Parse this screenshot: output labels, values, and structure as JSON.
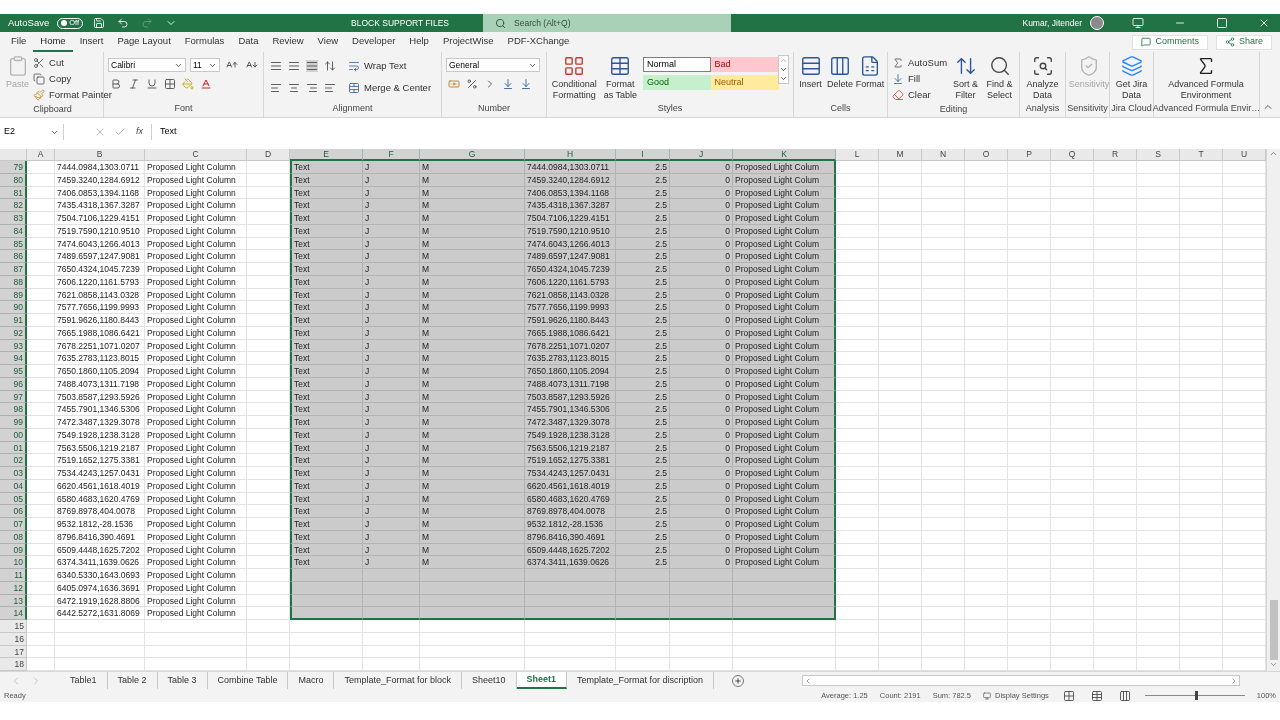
{
  "title_bar": {
    "autosave_label": "AutoSave",
    "autosave": {
      "label": "Off",
      "on": false
    },
    "title": "BLOCK SUPPORT FILES",
    "search": {
      "placeholder": "Search (Alt+Q)"
    },
    "user": "Kumar, Jitender"
  },
  "menu_tabs": [
    {
      "label": "File",
      "selected": false
    },
    {
      "label": "Home",
      "selected": true
    },
    {
      "label": "Insert",
      "selected": false
    },
    {
      "label": "Page Layout",
      "selected": false
    },
    {
      "label": "Formulas",
      "selected": false
    },
    {
      "label": "Data",
      "selected": false
    },
    {
      "label": "Review",
      "selected": false
    },
    {
      "label": "View",
      "selected": false
    },
    {
      "label": "Developer",
      "selected": false
    },
    {
      "label": "Help",
      "selected": false
    },
    {
      "label": "ProjectWise",
      "selected": false
    },
    {
      "label": "PDF-XChange",
      "selected": false
    }
  ],
  "actions": {
    "comments": "Comments",
    "share": "Share"
  },
  "ribbon": {
    "clipboard": {
      "label": "Clipboard",
      "paste": {
        "label": "Paste",
        "disabled": true
      },
      "cut": "Cut",
      "copy": "Copy",
      "format_painter": "Format Painter"
    },
    "font": {
      "label": "Font",
      "font_name": "Calibri",
      "font_size": "11"
    },
    "alignment": {
      "label": "Alignment",
      "wrap_text": "Wrap Text",
      "merge": "Merge & Center"
    },
    "number": {
      "label": "Number",
      "format": "General"
    },
    "styles": {
      "label": "Styles",
      "conditional": "Conditional Formatting",
      "format_table": "Format as Table",
      "cell_styles": [
        {
          "label": "Normal",
          "color": "#ffffff"
        },
        {
          "label": "Bad",
          "color": "#ffc7ce"
        },
        {
          "label": "Good",
          "color": "#c6efce"
        },
        {
          "label": "Neutral",
          "color": "#ffeb9c"
        }
      ]
    },
    "cells": {
      "label": "Cells",
      "buttons": [
        "Insert",
        "Delete",
        "Format"
      ]
    },
    "editing": {
      "label": "Editing",
      "autosum": "AutoSum",
      "fill": "Fill",
      "clear": "Clear",
      "sort": "Sort & Filter",
      "find": "Find & Select"
    },
    "analysis": {
      "label": "Analysis",
      "button": "Analyze Data"
    },
    "sensitivity": {
      "label": "Sensitivity",
      "button": {
        "label": "Sensitivity",
        "disabled": true
      }
    },
    "jira": {
      "label": "Jira Cloud",
      "button": "Get Jira Data"
    },
    "formula_env": {
      "label": "Advanced Formula Envir…",
      "button": "Advanced Formula Environment"
    }
  },
  "formula_bar": {
    "name_box": "E2",
    "insert_function": "fx",
    "formula": "Text"
  },
  "grid": {
    "columns": [
      {
        "label": "A",
        "selected": false,
        "kind": "text"
      },
      {
        "label": "B",
        "selected": false,
        "kind": "text"
      },
      {
        "label": "C",
        "selected": false,
        "kind": "text"
      },
      {
        "label": "D",
        "selected": false,
        "kind": "text"
      },
      {
        "label": "E",
        "selected": true,
        "kind": "text"
      },
      {
        "label": "F",
        "selected": true,
        "kind": "text"
      },
      {
        "label": "G",
        "selected": true,
        "kind": "text"
      },
      {
        "label": "H",
        "selected": true,
        "kind": "text"
      },
      {
        "label": "I",
        "selected": true,
        "kind": "number"
      },
      {
        "label": "J",
        "selected": true,
        "kind": "number"
      },
      {
        "label": "K",
        "selected": true,
        "kind": "text"
      },
      {
        "label": "L",
        "selected": false,
        "kind": "text"
      },
      {
        "label": "M",
        "selected": false,
        "kind": "text"
      },
      {
        "label": "N",
        "selected": false,
        "kind": "text"
      },
      {
        "label": "O",
        "selected": false,
        "kind": "text"
      },
      {
        "label": "P",
        "selected": false,
        "kind": "text"
      },
      {
        "label": "Q",
        "selected": false,
        "kind": "text"
      },
      {
        "label": "R",
        "selected": false,
        "kind": "text"
      },
      {
        "label": "S",
        "selected": false,
        "kind": "text"
      },
      {
        "label": "T",
        "selected": false,
        "kind": "text"
      },
      {
        "label": "U",
        "selected": false,
        "kind": "text"
      }
    ],
    "rows": [
      {
        "header": "79",
        "selected": true,
        "cells": {
          "b": "7444.0984,1303.0711",
          "c": "Proposed Light Column",
          "e": "Text",
          "f": "J",
          "g": "M",
          "h": "7444.0984,1303.0711",
          "i": "2.5",
          "j": "0",
          "k": "Proposed Light Colum"
        }
      },
      {
        "header": "80",
        "selected": true,
        "cells": {
          "b": "7459.3240,1284.6912",
          "c": "Proposed Light Column",
          "e": "Text",
          "f": "J",
          "g": "M",
          "h": "7459.3240,1284.6912",
          "i": "2.5",
          "j": "0",
          "k": "Proposed Light Colum"
        }
      },
      {
        "header": "81",
        "selected": true,
        "cells": {
          "b": "7406.0853,1394.1168",
          "c": "Proposed Light Column",
          "e": "Text",
          "f": "J",
          "g": "M",
          "h": "7406.0853,1394.1168",
          "i": "2.5",
          "j": "0",
          "k": "Proposed Light Colum"
        }
      },
      {
        "header": "82",
        "selected": true,
        "cells": {
          "b": "7435.4318,1367.3287",
          "c": "Proposed Light Column",
          "e": "Text",
          "f": "J",
          "g": "M",
          "h": "7435.4318,1367.3287",
          "i": "2.5",
          "j": "0",
          "k": "Proposed Light Colum"
        }
      },
      {
        "header": "83",
        "selected": true,
        "cells": {
          "b": "7504.7106,1229.4151",
          "c": "Proposed Light Column",
          "e": "Text",
          "f": "J",
          "g": "M",
          "h": "7504.7106,1229.4151",
          "i": "2.5",
          "j": "0",
          "k": "Proposed Light Colum"
        }
      },
      {
        "header": "84",
        "selected": true,
        "cells": {
          "b": "7519.7590,1210.9510",
          "c": "Proposed Light Column",
          "e": "Text",
          "f": "J",
          "g": "M",
          "h": "7519.7590,1210.9510",
          "i": "2.5",
          "j": "0",
          "k": "Proposed Light Colum"
        }
      },
      {
        "header": "85",
        "selected": true,
        "cells": {
          "b": "7474.6043,1266.4013",
          "c": "Proposed Light Column",
          "e": "Text",
          "f": "J",
          "g": "M",
          "h": "7474.6043,1266.4013",
          "i": "2.5",
          "j": "0",
          "k": "Proposed Light Colum"
        }
      },
      {
        "header": "86",
        "selected": true,
        "cells": {
          "b": "7489.6597,1247.9081",
          "c": "Proposed Light Column",
          "e": "Text",
          "f": "J",
          "g": "M",
          "h": "7489.6597,1247.9081",
          "i": "2.5",
          "j": "0",
          "k": "Proposed Light Colum"
        }
      },
      {
        "header": "87",
        "selected": true,
        "cells": {
          "b": "7650.4324,1045.7239",
          "c": "Proposed Light Column",
          "e": "Text",
          "f": "J",
          "g": "M",
          "h": "7650.4324,1045.7239",
          "i": "2.5",
          "j": "0",
          "k": "Proposed Light Colum"
        }
      },
      {
        "header": "88",
        "selected": true,
        "cells": {
          "b": "7606.1220,1161.5793",
          "c": "Proposed Light Column",
          "e": "Text",
          "f": "J",
          "g": "M",
          "h": "7606.1220,1161.5793",
          "i": "2.5",
          "j": "0",
          "k": "Proposed Light Colum"
        }
      },
      {
        "header": "89",
        "selected": true,
        "cells": {
          "b": "7621.0858,1143.0328",
          "c": "Proposed Light Column",
          "e": "Text",
          "f": "J",
          "g": "M",
          "h": "7621.0858,1143.0328",
          "i": "2.5",
          "j": "0",
          "k": "Proposed Light Colum"
        }
      },
      {
        "header": "90",
        "selected": true,
        "cells": {
          "b": "7577.7656,1199.9993",
          "c": "Proposed Light Column",
          "e": "Text",
          "f": "J",
          "g": "M",
          "h": "7577.7656,1199.9993",
          "i": "2.5",
          "j": "0",
          "k": "Proposed Light Colum"
        }
      },
      {
        "header": "91",
        "selected": true,
        "cells": {
          "b": "7591.9626,1180.8443",
          "c": "Proposed Light Column",
          "e": "Text",
          "f": "J",
          "g": "M",
          "h": "7591.9626,1180.8443",
          "i": "2.5",
          "j": "0",
          "k": "Proposed Light Colum"
        }
      },
      {
        "header": "92",
        "selected": true,
        "cells": {
          "b": "7665.1988,1086.6421",
          "c": "Proposed Light Column",
          "e": "Text",
          "f": "J",
          "g": "M",
          "h": "7665.1988,1086.6421",
          "i": "2.5",
          "j": "0",
          "k": "Proposed Light Colum"
        }
      },
      {
        "header": "93",
        "selected": true,
        "cells": {
          "b": "7678.2251,1071.0207",
          "c": "Proposed Light Column",
          "e": "Text",
          "f": "J",
          "g": "M",
          "h": "7678.2251,1071.0207",
          "i": "2.5",
          "j": "0",
          "k": "Proposed Light Colum"
        }
      },
      {
        "header": "94",
        "selected": true,
        "cells": {
          "b": "7635.2783,1123.8015",
          "c": "Proposed Light Column",
          "e": "Text",
          "f": "J",
          "g": "M",
          "h": "7635.2783,1123.8015",
          "i": "2.5",
          "j": "0",
          "k": "Proposed Light Colum"
        }
      },
      {
        "header": "95",
        "selected": true,
        "cells": {
          "b": "7650.1860,1105.2094",
          "c": "Proposed Light Column",
          "e": "Text",
          "f": "J",
          "g": "M",
          "h": "7650.1860,1105.2094",
          "i": "2.5",
          "j": "0",
          "k": "Proposed Light Colum"
        }
      },
      {
        "header": "96",
        "selected": true,
        "cells": {
          "b": "7488.4073,1311.7198",
          "c": "Proposed Light Column",
          "e": "Text",
          "f": "J",
          "g": "M",
          "h": "7488.4073,1311.7198",
          "i": "2.5",
          "j": "0",
          "k": "Proposed Light Colum"
        }
      },
      {
        "header": "97",
        "selected": true,
        "cells": {
          "b": "7503.8587,1293.5926",
          "c": "Proposed Light Column",
          "e": "Text",
          "f": "J",
          "g": "M",
          "h": "7503.8587,1293.5926",
          "i": "2.5",
          "j": "0",
          "k": "Proposed Light Colum"
        }
      },
      {
        "header": "98",
        "selected": true,
        "cells": {
          "b": "7455.7901,1346.5306",
          "c": "Proposed Light Column",
          "e": "Text",
          "f": "J",
          "g": "M",
          "h": "7455.7901,1346.5306",
          "i": "2.5",
          "j": "0",
          "k": "Proposed Light Colum"
        }
      },
      {
        "header": "99",
        "selected": true,
        "cells": {
          "b": "7472.3487,1329.3078",
          "c": "Proposed Light Column",
          "e": "Text",
          "f": "J",
          "g": "M",
          "h": "7472.3487,1329.3078",
          "i": "2.5",
          "j": "0",
          "k": "Proposed Light Colum"
        }
      },
      {
        "header": "00",
        "selected": true,
        "cells": {
          "b": "7549.1928,1238.3128",
          "c": "Proposed Light Column",
          "e": "Text",
          "f": "J",
          "g": "M",
          "h": "7549.1928,1238.3128",
          "i": "2.5",
          "j": "0",
          "k": "Proposed Light Colum"
        }
      },
      {
        "header": "01",
        "selected": true,
        "cells": {
          "b": "7563.5506,1219.2187",
          "c": "Proposed Light Column",
          "e": "Text",
          "f": "J",
          "g": "M",
          "h": "7563.5506,1219.2187",
          "i": "2.5",
          "j": "0",
          "k": "Proposed Light Colum"
        }
      },
      {
        "header": "02",
        "selected": true,
        "cells": {
          "b": "7519.1652,1275.3381",
          "c": "Proposed Light Column",
          "e": "Text",
          "f": "J",
          "g": "M",
          "h": "7519.1652,1275.3381",
          "i": "2.5",
          "j": "0",
          "k": "Proposed Light Colum"
        }
      },
      {
        "header": "03",
        "selected": true,
        "cells": {
          "b": "7534.4243,1257.0431",
          "c": "Proposed Light Column",
          "e": "Text",
          "f": "J",
          "g": "M",
          "h": "7534.4243,1257.0431",
          "i": "2.5",
          "j": "0",
          "k": "Proposed Light Colum"
        }
      },
      {
        "header": "04",
        "selected": true,
        "cells": {
          "b": "6620.4561,1618.4019",
          "c": "Proposed Light Column",
          "e": "Text",
          "f": "J",
          "g": "M",
          "h": "6620.4561,1618.4019",
          "i": "2.5",
          "j": "0",
          "k": "Proposed Light Colum"
        }
      },
      {
        "header": "05",
        "selected": true,
        "cells": {
          "b": "6580.4683,1620.4769",
          "c": "Proposed Light Column",
          "e": "Text",
          "f": "J",
          "g": "M",
          "h": "6580.4683,1620.4769",
          "i": "2.5",
          "j": "0",
          "k": "Proposed Light Colum"
        }
      },
      {
        "header": "06",
        "selected": true,
        "cells": {
          "b": "8769.8978,404.0078",
          "c": "Proposed Light Column",
          "e": "Text",
          "f": "J",
          "g": "M",
          "h": "8769.8978,404.0078",
          "i": "2.5",
          "j": "0",
          "k": "Proposed Light Colum"
        }
      },
      {
        "header": "07",
        "selected": true,
        "cells": {
          "b": "9532.1812,-28.1536",
          "c": "Proposed Light Column",
          "e": "Text",
          "f": "J",
          "g": "M",
          "h": "9532.1812,-28.1536",
          "i": "2.5",
          "j": "0",
          "k": "Proposed Light Colum"
        }
      },
      {
        "header": "08",
        "selected": true,
        "cells": {
          "b": "8796.8416,390.4691",
          "c": "Proposed Light Column",
          "e": "Text",
          "f": "J",
          "g": "M",
          "h": "8796.8416,390.4691",
          "i": "2.5",
          "j": "0",
          "k": "Proposed Light Colum"
        }
      },
      {
        "header": "09",
        "selected": true,
        "cells": {
          "b": "6509.4448,1625.7202",
          "c": "Proposed Light Column",
          "e": "Text",
          "f": "J",
          "g": "M",
          "h": "6509.4448,1625.7202",
          "i": "2.5",
          "j": "0",
          "k": "Proposed Light Colum"
        }
      },
      {
        "header": "10",
        "selected": true,
        "cells": {
          "b": "6374.3411,1639.0626",
          "c": "Proposed Light Column",
          "e": "Text",
          "f": "J",
          "g": "M",
          "h": "6374.3411,1639.0626",
          "i": "2.5",
          "j": "0",
          "k": "Proposed Light Colum"
        }
      },
      {
        "header": "11",
        "selected": true,
        "cells": {
          "b": "6340.5330,1643.0693",
          "c": "Proposed Light Column"
        }
      },
      {
        "header": "12",
        "selected": true,
        "cells": {
          "b": "6405.0974,1636.3691",
          "c": "Proposed Light Column"
        }
      },
      {
        "header": "13",
        "selected": true,
        "cells": {
          "b": "6472.1919,1628.8806",
          "c": "Proposed Light Column"
        }
      },
      {
        "header": "14",
        "selected": true,
        "cells": {
          "b": "6442.5272,1631.8069",
          "c": "Proposed Light Column"
        }
      },
      {
        "header": "15",
        "selected": false,
        "cells": {}
      },
      {
        "header": "16",
        "selected": false,
        "cells": {}
      },
      {
        "header": "17",
        "selected": false,
        "cells": {}
      },
      {
        "header": "18",
        "selected": false,
        "cells": {}
      }
    ]
  },
  "sheet_tabs": [
    {
      "label": "Table1",
      "selected": false
    },
    {
      "label": "Table 2",
      "selected": false
    },
    {
      "label": "Table 3",
      "selected": false
    },
    {
      "label": "Combine Table",
      "selected": false
    },
    {
      "label": "Macro",
      "selected": false
    },
    {
      "label": "Template_Format for block",
      "selected": false
    },
    {
      "label": "Sheet10",
      "selected": false
    },
    {
      "label": "Sheet1",
      "selected": true
    },
    {
      "label": "Template_Format for discription",
      "selected": false
    }
  ],
  "status_bar": {
    "mode": "Ready",
    "stats": [
      "Average: 1.25",
      "Count: 2191",
      "Sum: 782.5"
    ],
    "display_settings": "Display Settings",
    "zoom": {
      "label": "100%",
      "level": 0.5
    }
  }
}
